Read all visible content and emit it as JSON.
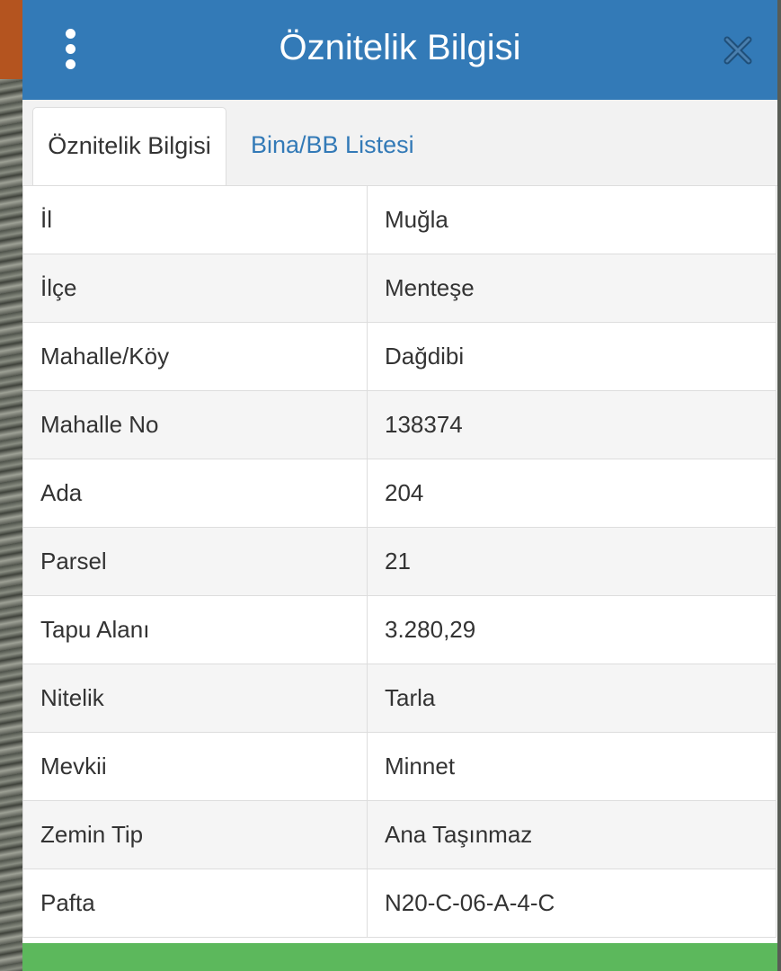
{
  "header": {
    "title": "Öznitelik Bilgisi"
  },
  "tabs": [
    {
      "label": "Öznitelik Bilgisi",
      "active": true
    },
    {
      "label": "Bina/BB Listesi",
      "active": false
    }
  ],
  "rows": [
    {
      "key": "İl",
      "value": "Muğla"
    },
    {
      "key": "İlçe",
      "value": "Menteşe"
    },
    {
      "key": "Mahalle/Köy",
      "value": "Dağdibi"
    },
    {
      "key": "Mahalle No",
      "value": "138374"
    },
    {
      "key": "Ada",
      "value": "204"
    },
    {
      "key": "Parsel",
      "value": "21"
    },
    {
      "key": "Tapu Alanı",
      "value": "3.280,29"
    },
    {
      "key": "Nitelik",
      "value": "Tarla"
    },
    {
      "key": "Mevkii",
      "value": "Minnet"
    },
    {
      "key": "Zemin Tip",
      "value": "Ana Taşınmaz"
    },
    {
      "key": "Pafta",
      "value": "N20-C-06-A-4-C"
    }
  ],
  "icons": {
    "menu": "vertical-dots-icon",
    "close": "close-icon"
  },
  "colors": {
    "header_bg": "#337ab7",
    "tab_link": "#337ab7",
    "footer_button": "#5cb85c"
  }
}
